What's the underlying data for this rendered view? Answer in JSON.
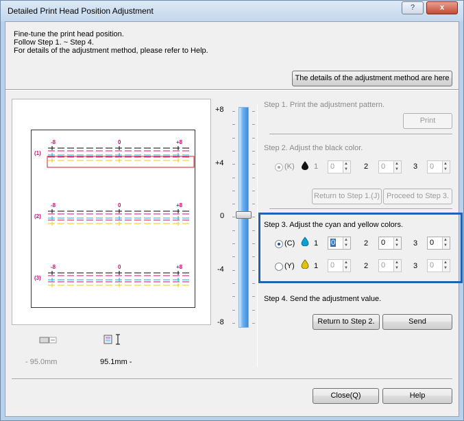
{
  "window": {
    "title": "Detailed Print Head Position Adjustment",
    "help_glyph": "?",
    "close_glyph": "x"
  },
  "intro": {
    "line1": "Fine-tune the print head position.",
    "line2": "Follow Step 1. ~ Step 4.",
    "line3": "For details of the adjustment method, please refer to Help."
  },
  "details_button": "The details of the adjustment method are here",
  "preview": {
    "groups": [
      {
        "id": "(1)",
        "left": "-8",
        "center": "0",
        "right": "+8"
      },
      {
        "id": "(2)",
        "left": "-8",
        "center": "0",
        "right": "+8"
      },
      {
        "id": "(3)",
        "left": "-8",
        "center": "0",
        "right": "+8"
      }
    ],
    "left_value": "- 95.0mm",
    "right_value": "95.1mm -"
  },
  "slider": {
    "labels": [
      "+8",
      "+4",
      "0",
      "-4",
      "-8"
    ],
    "value": 0
  },
  "step1": {
    "label": "Step 1. Print the adjustment pattern.",
    "print_button": "Print"
  },
  "step2": {
    "label": "Step 2. Adjust the black color.",
    "radio_label": "(K)",
    "fields": [
      {
        "label": "1",
        "value": "0"
      },
      {
        "label": "2",
        "value": "0"
      },
      {
        "label": "3",
        "value": "0"
      }
    ],
    "return_button": "Return to Step 1.(J)",
    "proceed_button": "Proceed to Step 3."
  },
  "step3": {
    "label": "Step 3. Adjust the cyan and yellow colors.",
    "cyan": {
      "radio_label": "(C)",
      "fields": [
        {
          "label": "1",
          "value": "0"
        },
        {
          "label": "2",
          "value": "0"
        },
        {
          "label": "3",
          "value": "0"
        }
      ]
    },
    "yellow": {
      "radio_label": "(Y)",
      "fields": [
        {
          "label": "1",
          "value": "0"
        },
        {
          "label": "2",
          "value": "0"
        },
        {
          "label": "3",
          "value": "0"
        }
      ]
    }
  },
  "step4": {
    "label": "Step 4. Send the adjustment value.",
    "return_button": "Return to Step 2.",
    "send_button": "Send"
  },
  "footer": {
    "close_button": "Close(Q)",
    "help_button": "Help"
  },
  "colors": {
    "black": "#000000",
    "cyan": "#00b4e6",
    "magenta": "#e0007a",
    "yellow": "#f0c800",
    "accent_box": "#1d62b3",
    "slider_blue": "#3b8de0",
    "highlight_red": "#d22020"
  }
}
